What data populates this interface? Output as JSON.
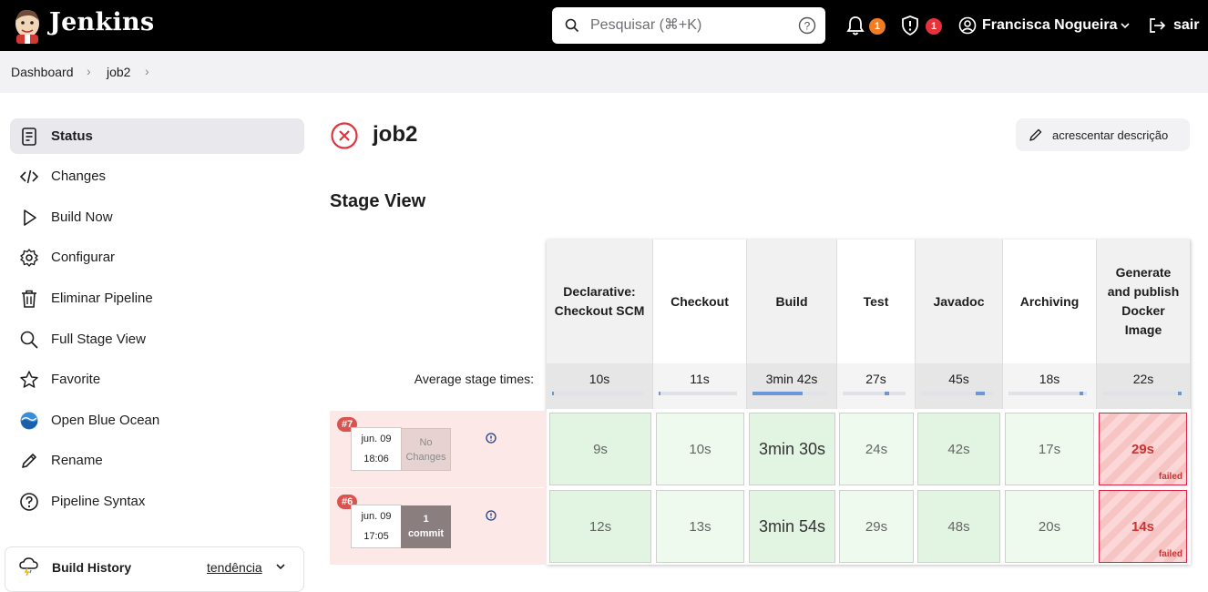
{
  "header": {
    "brand": "Jenkins",
    "search_placeholder": "Pesquisar (⌘+K)",
    "notif_count": "1",
    "security_count": "1",
    "user_name": "Francisca Nogueira",
    "logout_label": "sair",
    "colors": {
      "notif_badge": "#f07c24",
      "security_badge": "#e5323b"
    }
  },
  "breadcrumb": {
    "items": [
      "Dashboard",
      "job2"
    ]
  },
  "sidebar": {
    "items": [
      {
        "label": "Status",
        "icon": "document-icon"
      },
      {
        "label": "Changes",
        "icon": "code-icon"
      },
      {
        "label": "Build Now",
        "icon": "play-icon"
      },
      {
        "label": "Configurar",
        "icon": "gear-icon"
      },
      {
        "label": "Eliminar Pipeline",
        "icon": "trash-icon"
      },
      {
        "label": "Full Stage View",
        "icon": "search-icon"
      },
      {
        "label": "Favorite",
        "icon": "star-icon"
      },
      {
        "label": "Open Blue Ocean",
        "icon": "blue-ocean-icon"
      },
      {
        "label": "Rename",
        "icon": "pencil-icon"
      },
      {
        "label": "Pipeline Syntax",
        "icon": "help-icon"
      }
    ],
    "build_history": {
      "label": "Build History",
      "trend": "tendência"
    }
  },
  "main": {
    "job_title": "job2",
    "add_description": "acrescentar descrição",
    "stage_view_title": "Stage View"
  },
  "stage_view": {
    "avg_label": "Average stage times:",
    "stages": [
      {
        "name": "Declarative: Checkout SCM",
        "avg": "10s",
        "avg_fraction": 0.0
      },
      {
        "name": "Checkout",
        "avg": "11s",
        "avg_fraction": 0.0
      },
      {
        "name": "Build",
        "avg": "3min 42s",
        "avg_fraction": 0.6
      },
      {
        "name": "Test",
        "avg": "27s",
        "avg_fraction": 0.7
      },
      {
        "name": "Javadoc",
        "avg": "45s",
        "avg_fraction": 0.85
      },
      {
        "name": "Archiving",
        "avg": "18s",
        "avg_fraction": 0.9
      },
      {
        "name": "Generate and publish Docker Image",
        "avg": "22s",
        "avg_fraction": 1.0
      }
    ],
    "runs": [
      {
        "id": "#7",
        "date": "jun. 09",
        "time": "18:06",
        "changes": "No Changes",
        "cells": [
          {
            "value": "9s",
            "status": "success"
          },
          {
            "value": "10s",
            "status": "success"
          },
          {
            "value": "3min 30s",
            "status": "success"
          },
          {
            "value": "24s",
            "status": "success"
          },
          {
            "value": "42s",
            "status": "success"
          },
          {
            "value": "17s",
            "status": "success"
          },
          {
            "value": "29s",
            "status": "failed",
            "status_label": "failed"
          }
        ]
      },
      {
        "id": "#6",
        "date": "jun. 09",
        "time": "17:05",
        "changes_count": "1",
        "changes_label": "commit",
        "cells": [
          {
            "value": "12s",
            "status": "success"
          },
          {
            "value": "13s",
            "status": "success"
          },
          {
            "value": "3min 54s",
            "status": "success"
          },
          {
            "value": "29s",
            "status": "success"
          },
          {
            "value": "48s",
            "status": "success"
          },
          {
            "value": "20s",
            "status": "success"
          },
          {
            "value": "14s",
            "status": "failed",
            "status_label": "failed"
          }
        ]
      }
    ]
  }
}
